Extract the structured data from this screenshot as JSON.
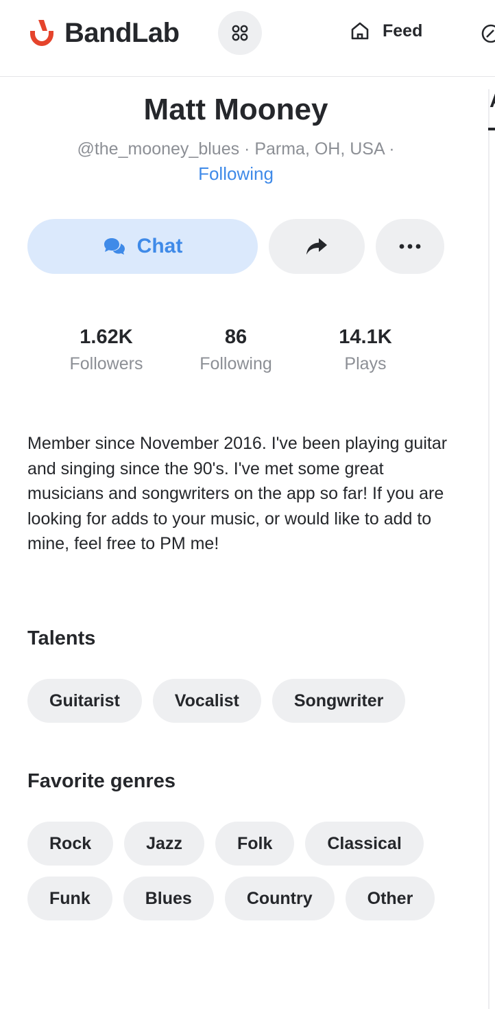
{
  "header": {
    "brand": "BandLab",
    "nav_feed_label": "Feed",
    "brand_color": "#e5442c"
  },
  "rail": {
    "tab_initial": "A"
  },
  "profile": {
    "name": "Matt Mooney",
    "meta": "@the_mooney_blues · Parma, OH, USA ·",
    "follow_status": "Following"
  },
  "actions": {
    "chat_label": "Chat",
    "share_icon": "share-arrow-icon",
    "more_icon": "more-dots-icon",
    "accent_color": "#3f8ae8"
  },
  "stats": [
    {
      "value": "1.62K",
      "label": "Followers"
    },
    {
      "value": "86",
      "label": "Following"
    },
    {
      "value": "14.1K",
      "label": "Plays"
    }
  ],
  "bio": "Member since November 2016. I've been playing guitar and singing since the 90's. I've met some great musicians and songwriters on the app so far! If you are looking for adds to your music, or would like to add to mine, feel free to PM me!",
  "talents": {
    "title": "Talents",
    "items": [
      "Guitarist",
      "Vocalist",
      "Songwriter"
    ]
  },
  "genres": {
    "title": "Favorite genres",
    "items": [
      "Rock",
      "Jazz",
      "Folk",
      "Classical",
      "Funk",
      "Blues",
      "Country",
      "Other"
    ]
  }
}
